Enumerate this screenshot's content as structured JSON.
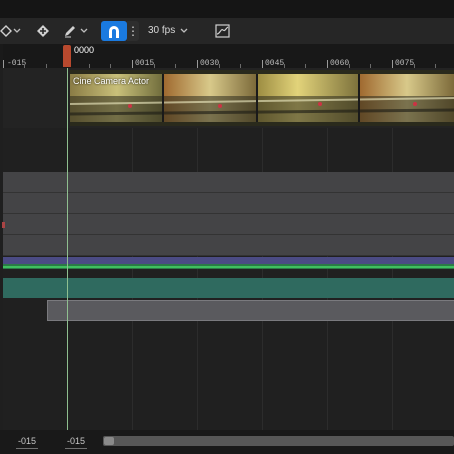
{
  "toolbar": {
    "transform_icon": "diamond-key-icon",
    "key_icon": "keyframe-icon",
    "edit_icon": "pencil-icon",
    "snap_icon": "magnet-icon",
    "more_icon": "vertical-dots-icon",
    "fps_label": "30 fps",
    "extra_icon": "curve-editor-icon",
    "snap_active_color": "#1a7ae0"
  },
  "ruler": {
    "current_frame": "0000",
    "labels": [
      "-015",
      "0015",
      "0030",
      "0045",
      "0060",
      "0075"
    ]
  },
  "tracks": {
    "camera_clip_label": "Cine Camera Actor"
  },
  "playback_range": {
    "start": "-015",
    "end": "-015"
  },
  "colors": {
    "playhead": "#b8492e",
    "section_teal": "#2f6a5f",
    "section_purple": "#4b4b84",
    "section_green": "#3fbf5f"
  }
}
